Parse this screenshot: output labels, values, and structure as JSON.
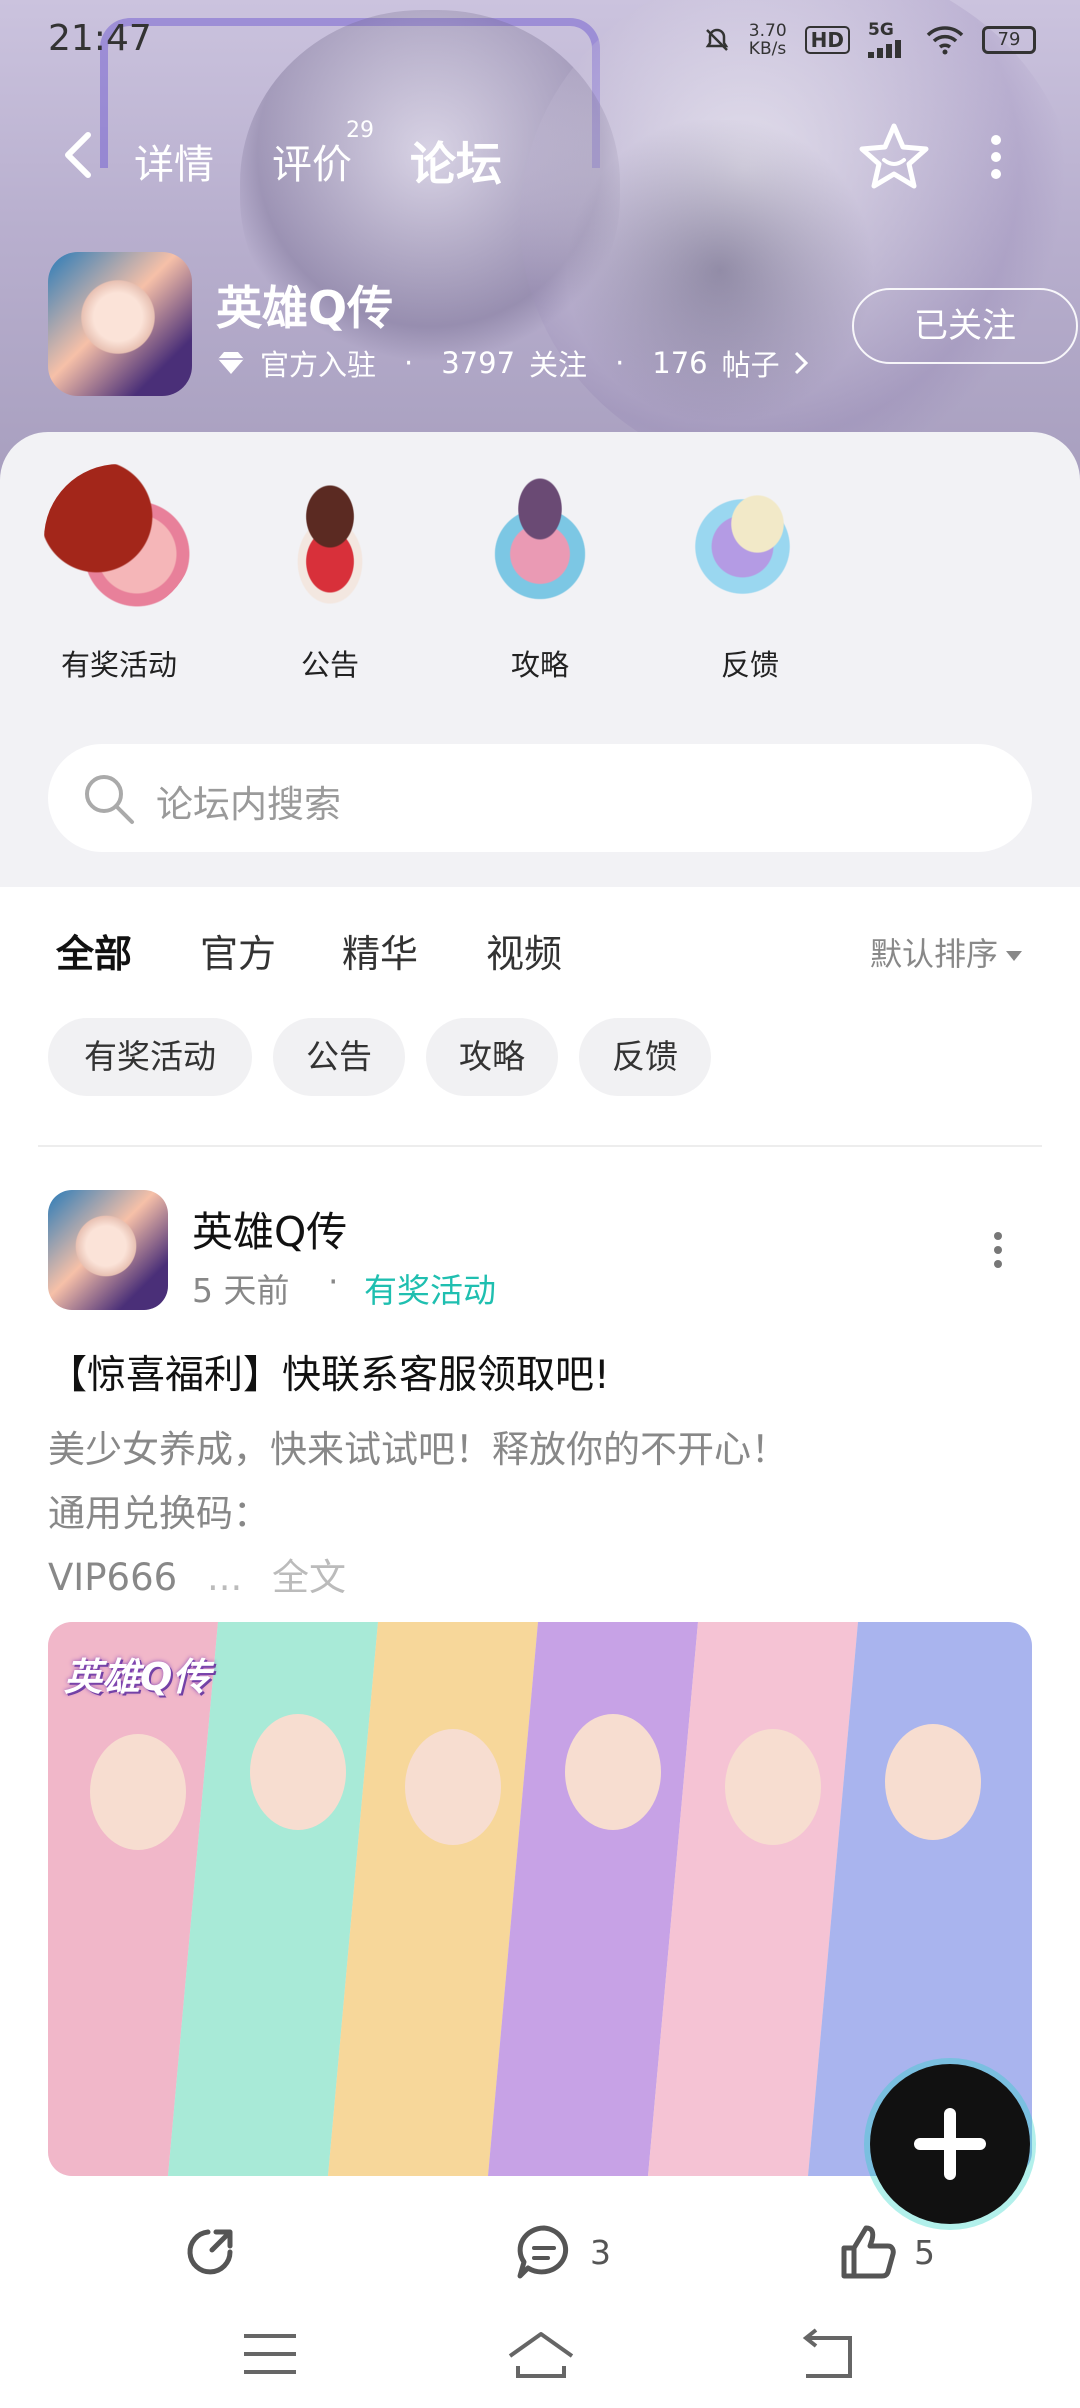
{
  "status_bar": {
    "time": "21:47",
    "net_speed_top": "3.70",
    "net_speed_bottom": "KB/s",
    "hd": "HD",
    "network": "5G",
    "battery": "79"
  },
  "nav": {
    "tabs": [
      {
        "label": "详情"
      },
      {
        "label": "评价",
        "count": "29"
      },
      {
        "label": "论坛"
      }
    ],
    "active_tab": "论坛"
  },
  "game": {
    "name": "英雄Q传",
    "official": "官方入驻",
    "follow_count": "3797",
    "follow_label": "关注",
    "post_count": "176",
    "post_label": "帖子",
    "follow_button": "已关注"
  },
  "categories": [
    {
      "label": "有奖活动"
    },
    {
      "label": "公告"
    },
    {
      "label": "攻略"
    },
    {
      "label": "反馈"
    }
  ],
  "search": {
    "placeholder": "论坛内搜索"
  },
  "filter_tabs": [
    {
      "label": "全部"
    },
    {
      "label": "官方"
    },
    {
      "label": "精华"
    },
    {
      "label": "视频"
    }
  ],
  "sort": {
    "label": "默认排序"
  },
  "chips": [
    {
      "label": "有奖活动"
    },
    {
      "label": "公告"
    },
    {
      "label": "攻略"
    },
    {
      "label": "反馈"
    }
  ],
  "post": {
    "author": "英雄Q传",
    "time": "5 天前",
    "separator": "·",
    "tag": "有奖活动",
    "title": "【惊喜福利】快联系客服领取吧!",
    "body_line1": "美少女养成，快来试试吧！释放你的不开心！",
    "body_line2": "通用兑换码：",
    "body_line3": "VIP666",
    "ellipsis": "...",
    "full_text": "全文",
    "image_logo": "英雄Q传",
    "comment_count": "3",
    "like_count": "5"
  },
  "colors": {
    "accent": "#22d3c5",
    "tag_text": "#1fbfb0"
  }
}
